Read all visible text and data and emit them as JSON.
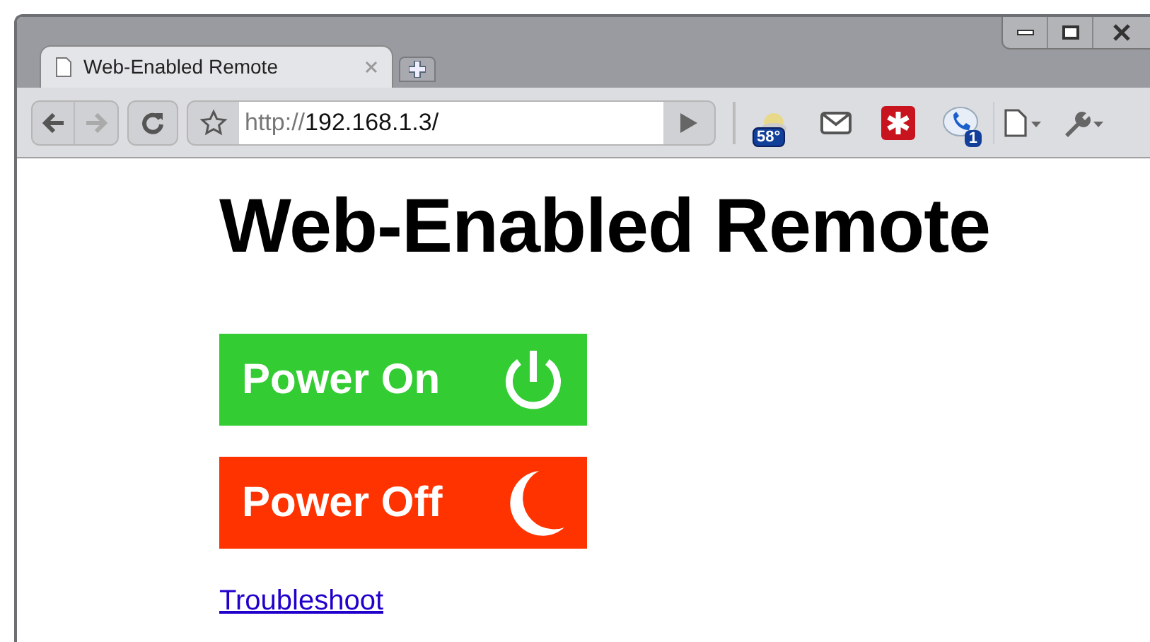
{
  "tabs": [
    {
      "label": "Web-Enabled Remote",
      "selected": true
    }
  ],
  "address": {
    "scheme": "http://",
    "host": "192.168.1.3/"
  },
  "extensions": [
    {
      "kind": "weather",
      "badge": "58°"
    },
    {
      "kind": "mail"
    },
    {
      "kind": "lastpass"
    },
    {
      "kind": "voice",
      "badge": "1"
    }
  ],
  "page": {
    "heading": "Web-Enabled Remote",
    "buttons": [
      {
        "kind": "power",
        "label": "Power On",
        "color": "#33cc33"
      },
      {
        "kind": "sleep",
        "label": "Power Off",
        "color": "#ff3300"
      }
    ],
    "link": "Troubleshoot"
  }
}
